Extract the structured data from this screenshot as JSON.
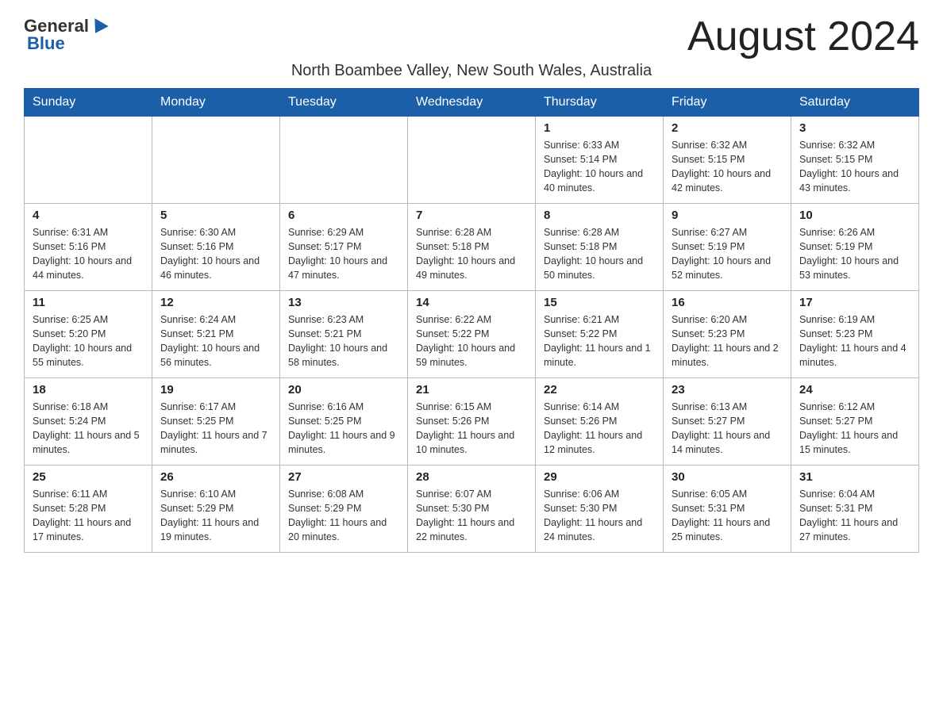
{
  "header": {
    "logo_general": "General",
    "logo_blue": "Blue",
    "month_title": "August 2024",
    "location": "North Boambee Valley, New South Wales, Australia"
  },
  "weekdays": [
    "Sunday",
    "Monday",
    "Tuesday",
    "Wednesday",
    "Thursday",
    "Friday",
    "Saturday"
  ],
  "weeks": [
    [
      {
        "day": "",
        "info": ""
      },
      {
        "day": "",
        "info": ""
      },
      {
        "day": "",
        "info": ""
      },
      {
        "day": "",
        "info": ""
      },
      {
        "day": "1",
        "info": "Sunrise: 6:33 AM\nSunset: 5:14 PM\nDaylight: 10 hours and 40 minutes."
      },
      {
        "day": "2",
        "info": "Sunrise: 6:32 AM\nSunset: 5:15 PM\nDaylight: 10 hours and 42 minutes."
      },
      {
        "day": "3",
        "info": "Sunrise: 6:32 AM\nSunset: 5:15 PM\nDaylight: 10 hours and 43 minutes."
      }
    ],
    [
      {
        "day": "4",
        "info": "Sunrise: 6:31 AM\nSunset: 5:16 PM\nDaylight: 10 hours and 44 minutes."
      },
      {
        "day": "5",
        "info": "Sunrise: 6:30 AM\nSunset: 5:16 PM\nDaylight: 10 hours and 46 minutes."
      },
      {
        "day": "6",
        "info": "Sunrise: 6:29 AM\nSunset: 5:17 PM\nDaylight: 10 hours and 47 minutes."
      },
      {
        "day": "7",
        "info": "Sunrise: 6:28 AM\nSunset: 5:18 PM\nDaylight: 10 hours and 49 minutes."
      },
      {
        "day": "8",
        "info": "Sunrise: 6:28 AM\nSunset: 5:18 PM\nDaylight: 10 hours and 50 minutes."
      },
      {
        "day": "9",
        "info": "Sunrise: 6:27 AM\nSunset: 5:19 PM\nDaylight: 10 hours and 52 minutes."
      },
      {
        "day": "10",
        "info": "Sunrise: 6:26 AM\nSunset: 5:19 PM\nDaylight: 10 hours and 53 minutes."
      }
    ],
    [
      {
        "day": "11",
        "info": "Sunrise: 6:25 AM\nSunset: 5:20 PM\nDaylight: 10 hours and 55 minutes."
      },
      {
        "day": "12",
        "info": "Sunrise: 6:24 AM\nSunset: 5:21 PM\nDaylight: 10 hours and 56 minutes."
      },
      {
        "day": "13",
        "info": "Sunrise: 6:23 AM\nSunset: 5:21 PM\nDaylight: 10 hours and 58 minutes."
      },
      {
        "day": "14",
        "info": "Sunrise: 6:22 AM\nSunset: 5:22 PM\nDaylight: 10 hours and 59 minutes."
      },
      {
        "day": "15",
        "info": "Sunrise: 6:21 AM\nSunset: 5:22 PM\nDaylight: 11 hours and 1 minute."
      },
      {
        "day": "16",
        "info": "Sunrise: 6:20 AM\nSunset: 5:23 PM\nDaylight: 11 hours and 2 minutes."
      },
      {
        "day": "17",
        "info": "Sunrise: 6:19 AM\nSunset: 5:23 PM\nDaylight: 11 hours and 4 minutes."
      }
    ],
    [
      {
        "day": "18",
        "info": "Sunrise: 6:18 AM\nSunset: 5:24 PM\nDaylight: 11 hours and 5 minutes."
      },
      {
        "day": "19",
        "info": "Sunrise: 6:17 AM\nSunset: 5:25 PM\nDaylight: 11 hours and 7 minutes."
      },
      {
        "day": "20",
        "info": "Sunrise: 6:16 AM\nSunset: 5:25 PM\nDaylight: 11 hours and 9 minutes."
      },
      {
        "day": "21",
        "info": "Sunrise: 6:15 AM\nSunset: 5:26 PM\nDaylight: 11 hours and 10 minutes."
      },
      {
        "day": "22",
        "info": "Sunrise: 6:14 AM\nSunset: 5:26 PM\nDaylight: 11 hours and 12 minutes."
      },
      {
        "day": "23",
        "info": "Sunrise: 6:13 AM\nSunset: 5:27 PM\nDaylight: 11 hours and 14 minutes."
      },
      {
        "day": "24",
        "info": "Sunrise: 6:12 AM\nSunset: 5:27 PM\nDaylight: 11 hours and 15 minutes."
      }
    ],
    [
      {
        "day": "25",
        "info": "Sunrise: 6:11 AM\nSunset: 5:28 PM\nDaylight: 11 hours and 17 minutes."
      },
      {
        "day": "26",
        "info": "Sunrise: 6:10 AM\nSunset: 5:29 PM\nDaylight: 11 hours and 19 minutes."
      },
      {
        "day": "27",
        "info": "Sunrise: 6:08 AM\nSunset: 5:29 PM\nDaylight: 11 hours and 20 minutes."
      },
      {
        "day": "28",
        "info": "Sunrise: 6:07 AM\nSunset: 5:30 PM\nDaylight: 11 hours and 22 minutes."
      },
      {
        "day": "29",
        "info": "Sunrise: 6:06 AM\nSunset: 5:30 PM\nDaylight: 11 hours and 24 minutes."
      },
      {
        "day": "30",
        "info": "Sunrise: 6:05 AM\nSunset: 5:31 PM\nDaylight: 11 hours and 25 minutes."
      },
      {
        "day": "31",
        "info": "Sunrise: 6:04 AM\nSunset: 5:31 PM\nDaylight: 11 hours and 27 minutes."
      }
    ]
  ]
}
